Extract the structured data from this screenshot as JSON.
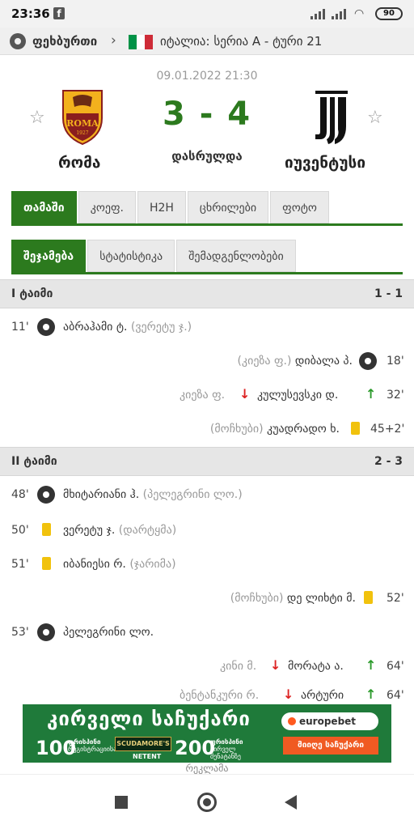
{
  "status_bar": {
    "time": "23:36",
    "fb_icon": "f",
    "battery": "90"
  },
  "breadcrumb": {
    "sport": "ფეხბურთი",
    "league": "იტალია: სერია A - ტური 21",
    "flag_colors": [
      "#009246",
      "#ffffff",
      "#ce2b37"
    ]
  },
  "match": {
    "datetime": "09.01.2022 21:30",
    "score": "3 - 4",
    "status": "დასრულდა",
    "home": "რომა",
    "away": "იუვენტუსი",
    "home_crest_text": "ROMA",
    "home_crest_year": "1927",
    "accent": "#2c7a1e"
  },
  "tabs": [
    "თამაში",
    "კოეფ.",
    "H2H",
    "ცხრილები",
    "ფოტო"
  ],
  "subtabs": [
    "შეჯამება",
    "სტატისტიკა",
    "შემადგენლობები"
  ],
  "half1": {
    "label": "I ტაიმი",
    "score": "1 - 1",
    "events": [
      {
        "minute": "11'",
        "player": "აბრაჰამი ტ.",
        "extra": "(ვერეტუ ჯ.)"
      },
      {
        "minute": "18'",
        "player": "დიბალა პ.",
        "extra": "(კიეზა ფ.)"
      },
      {
        "minute": "32'",
        "player": "კულუსევსკი დ.",
        "extra": "კიეზა ფ."
      },
      {
        "minute": "45+2'",
        "player": "კუადრადო ხ.",
        "extra": "(მოჩხუბი)"
      }
    ]
  },
  "half2": {
    "label": "II ტაიმი",
    "score": "2 - 3",
    "events": [
      {
        "minute": "48'",
        "player": "მხიტარიანი ჰ.",
        "extra": "(პელეგრინი ლო.)"
      },
      {
        "minute": "50'",
        "player": "ვერეტუ ჯ.",
        "extra": "(დარტყმა)"
      },
      {
        "minute": "51'",
        "player": "იბანიესი რ.",
        "extra": "(ჯარიმა)"
      },
      {
        "minute": "52'",
        "player": "დე ლიხტი მ.",
        "extra": "(მოჩხუბი)"
      },
      {
        "minute": "53'",
        "player": "პელეგრინი ლო.",
        "extra": ""
      },
      {
        "minute": "64'",
        "player": "მორატა ა.",
        "extra": "კინი მ."
      },
      {
        "minute": "64'",
        "player": "არტური",
        "extra": "ბენტანკური რ."
      }
    ]
  },
  "ad": {
    "title": "კირველი საჩუქარი",
    "n1": "100",
    "n1_text": "ფრისპინი",
    "n1_sub": "რეგისტრაციისას",
    "game": "SCUDAMORE'S",
    "provider": "NETENT",
    "n2": "200",
    "n2_text": "ფრისპინი",
    "n2_sub": "პირველ შენატანზე",
    "brand": "europebet",
    "cta": "მიიღე საჩუქარი",
    "label": "რეკლამა"
  }
}
